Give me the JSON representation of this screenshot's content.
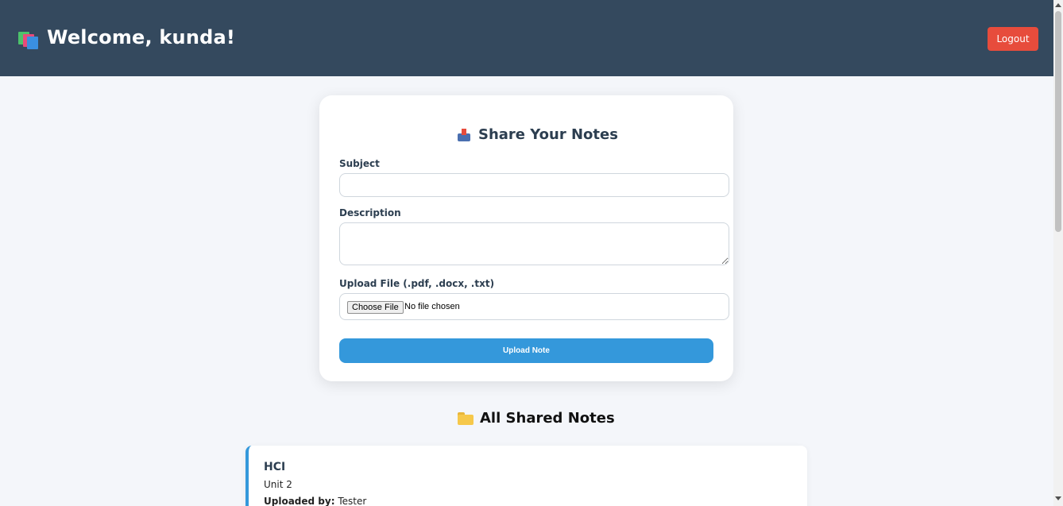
{
  "header": {
    "welcome": "Welcome, kunda!",
    "brand_icon": "books-icon",
    "logout_label": "Logout"
  },
  "form": {
    "title": "Share Your Notes",
    "title_icon": "inbox-tray-icon",
    "subject_label": "Subject",
    "subject_value": "",
    "description_label": "Description",
    "description_value": "",
    "file_label": "Upload File (.pdf, .docx, .txt)",
    "choose_file_label": "Choose File",
    "no_file_text": "No file chosen",
    "submit_label": "Upload Note"
  },
  "notes_section": {
    "title": "All Shared Notes",
    "title_icon": "folder-icon",
    "notes": [
      {
        "subject": "HCI",
        "description": "Unit 2",
        "uploaded_by_label": "Uploaded by:",
        "uploaded_by": "Tester"
      }
    ]
  },
  "colors": {
    "header_bg": "#34495e",
    "accent": "#3498db",
    "logout": "#e74c3c",
    "page_bg": "#f4f6fa"
  }
}
